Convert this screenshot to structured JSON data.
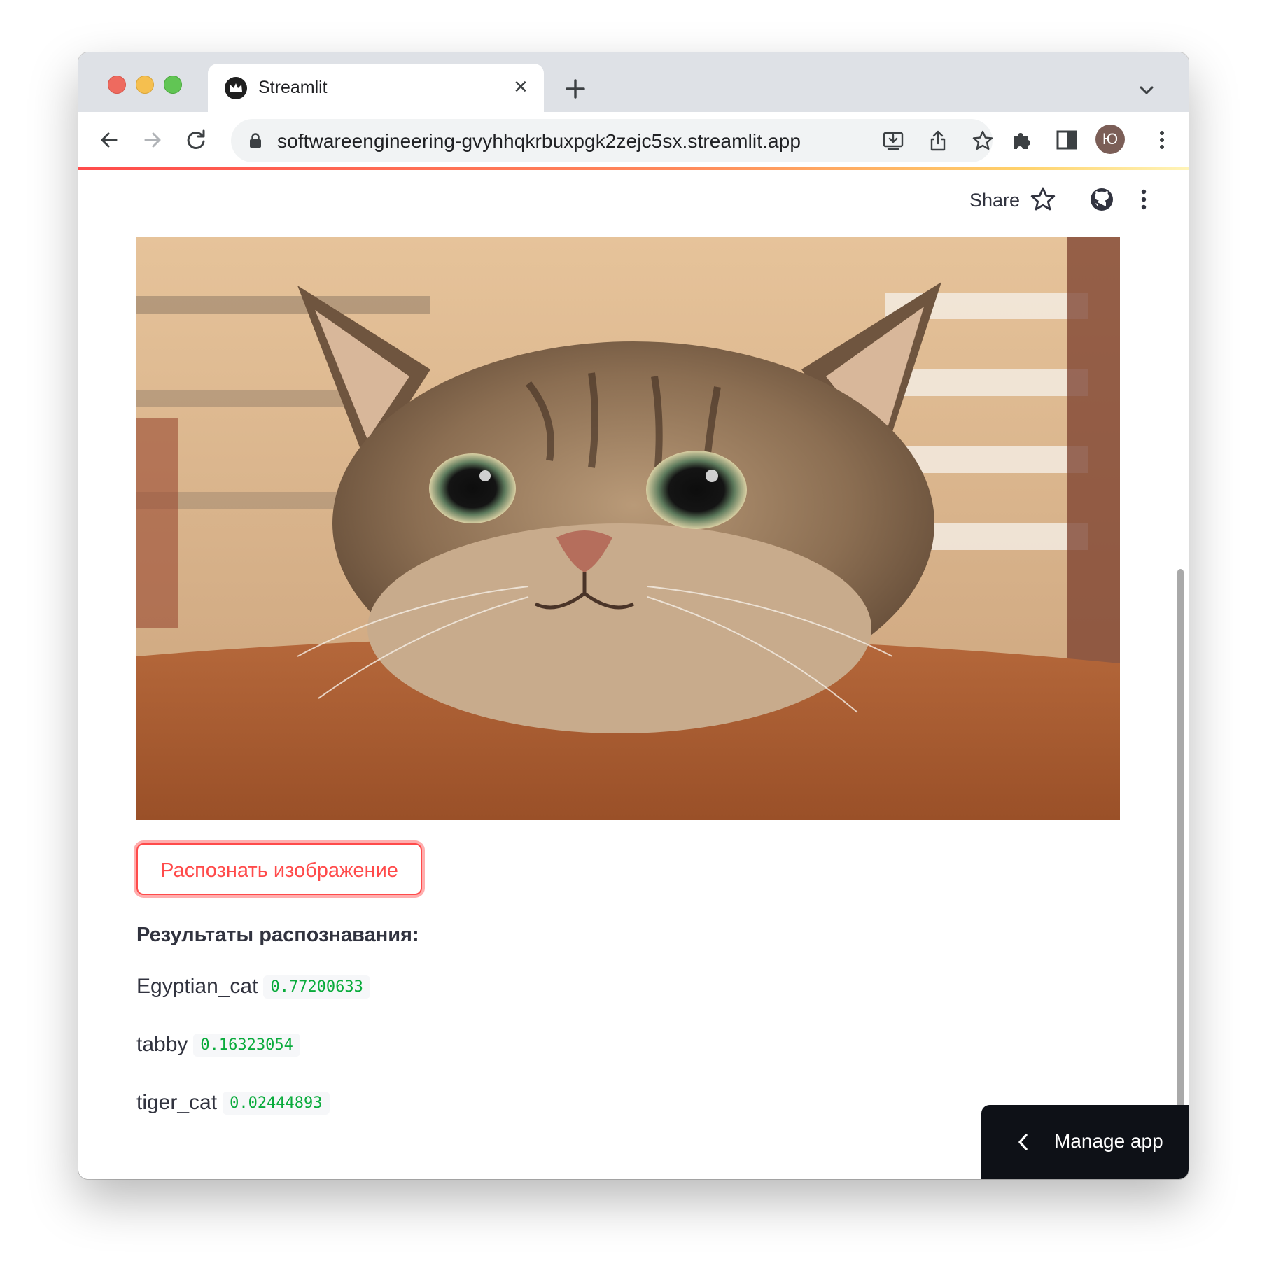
{
  "browser": {
    "tab": {
      "title": "Streamlit",
      "close_glyph": "✕"
    },
    "omnibox": {
      "url": "softwareengineering-gvyhhqkrbuxpgk2zejc5sx.streamlit.app"
    },
    "profile_initial": "Ю",
    "icons": {
      "back": "arrow-left-icon",
      "forward": "arrow-right-icon",
      "reload": "reload-icon",
      "lock": "lock-icon",
      "install": "install-app-icon",
      "share": "share-icon",
      "bookmark": "star-icon",
      "extensions": "puzzle-icon",
      "side_panel": "side-panel-icon",
      "menu": "kebab-menu-icon"
    }
  },
  "app_header": {
    "share_label": "Share",
    "icons": [
      "star-icon",
      "github-icon",
      "kebab-menu-icon"
    ]
  },
  "main": {
    "image_alt": "Tabby cat peeking over a wooden table",
    "recognize_button": "Распознать изображение",
    "results_title": "Результаты распознавания:",
    "results": [
      {
        "label": "Egyptian_cat",
        "score": "0.77200633"
      },
      {
        "label": "tabby",
        "score": "0.16323054"
      },
      {
        "label": "tiger_cat",
        "score": "0.02444893"
      }
    ]
  },
  "manage_app": {
    "label": "Manage app"
  },
  "colors": {
    "accent": "#ff4b4b",
    "score_text": "#09ab3b",
    "text": "#31333f",
    "manage_bg": "#0e1117"
  }
}
